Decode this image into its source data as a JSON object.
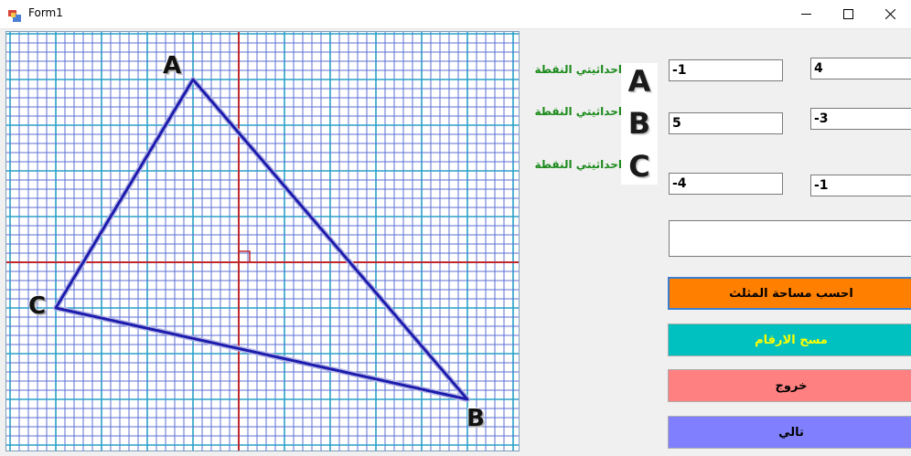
{
  "window": {
    "title": "Form1"
  },
  "points": {
    "A": {
      "letter": "A",
      "label": "احداثيتي النقطة",
      "x": "-1",
      "y": "4"
    },
    "B": {
      "letter": "B",
      "label": "احداثيتي النقطة",
      "x": "5",
      "y": "-3"
    },
    "C": {
      "letter": "C",
      "label": "احداثيتي النقطة",
      "x": "-4",
      "y": "-1"
    }
  },
  "result": {
    "value": ""
  },
  "buttons": {
    "calculate": "احسب مساحة المثلث",
    "clear": "مسح الارقام",
    "exit": "خروج",
    "next": "تالي"
  },
  "colors": {
    "grid_minor": "#5b6fd6",
    "grid_major": "#2aa0c8",
    "axis": "#c0282d",
    "triangle": "#1c1cad",
    "calculate_button": "#ff8000",
    "clear_button": "#00c0c0",
    "exit_button": "#ff8080",
    "next_button": "#8080ff",
    "label_text": "#1c8a1c"
  }
}
